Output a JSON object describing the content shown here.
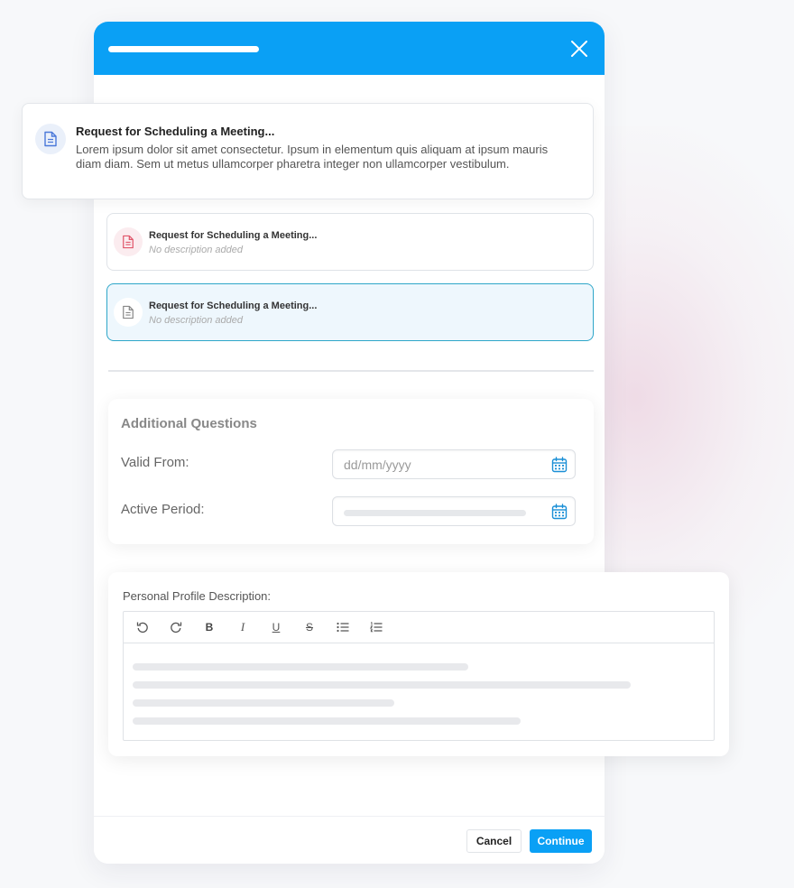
{
  "modal": {
    "close_icon": "close-icon"
  },
  "float_card": {
    "title": "Request for Scheduling a Meeting...",
    "description": "Lorem ipsum dolor sit amet consectetur. Ipsum in elementum quis aliquam at ipsum mauris diam diam. Sem ut metus ullamcorper pharetra integer non ullamcorper vestibulum.",
    "icon": "document-icon",
    "icon_color": "#4a78d9"
  },
  "documents": [
    {
      "title": "Request for Scheduling a Meeting...",
      "subtitle": "No description added",
      "icon": "document-icon",
      "icon_color": "#e0566a",
      "selected": false
    },
    {
      "title": "Request for Scheduling a Meeting...",
      "subtitle": "No description added",
      "icon": "document-icon",
      "icon_color": "#888888",
      "selected": true
    }
  ],
  "questions": {
    "title": "Additional Questions",
    "valid_from_label": "Valid From:",
    "valid_from_placeholder": "dd/mm/yyyy",
    "active_period_label": "Active Period:",
    "calendar_icon": "calendar-icon"
  },
  "profile": {
    "label": "Personal Profile Description:",
    "toolbar": {
      "undo": "undo-icon",
      "redo": "redo-icon",
      "bold": "B",
      "italic": "I",
      "underline": "U",
      "strike": "S",
      "bullet_list": "bullet-list-icon",
      "numbered_list": "numbered-list-icon"
    }
  },
  "footer": {
    "cancel_label": "Cancel",
    "continue_label": "Continue"
  },
  "colors": {
    "accent": "#0aa0f5",
    "selected_border": "#2ea6c9",
    "selected_bg": "#eef7fd"
  }
}
